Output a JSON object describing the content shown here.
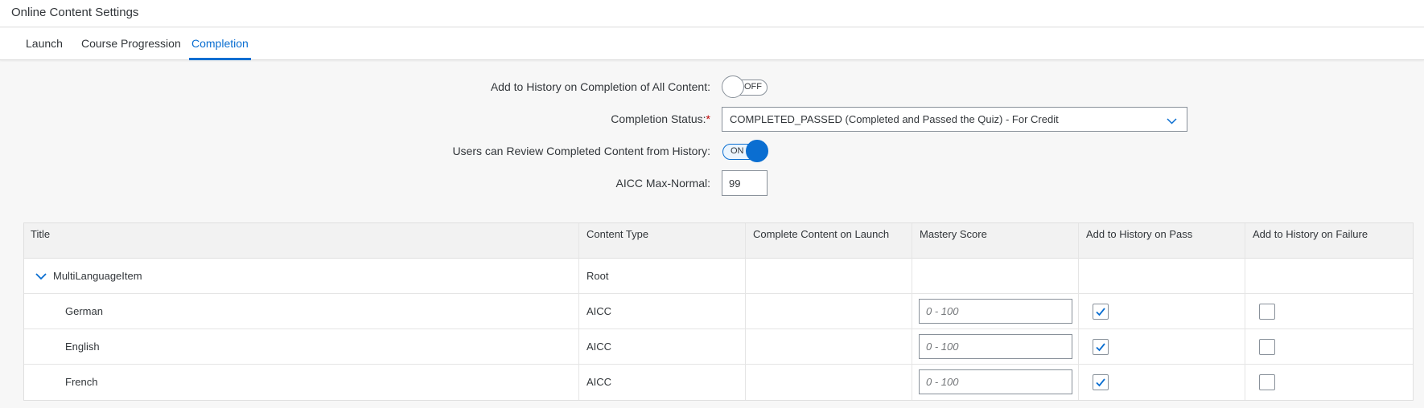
{
  "window": {
    "title": "Online Content Settings"
  },
  "tabs": [
    {
      "label": "Launch",
      "active": false
    },
    {
      "label": "Course Progression",
      "active": false
    },
    {
      "label": "Completion",
      "active": true
    }
  ],
  "form": {
    "add_history_label": "Add to History on Completion of All Content:",
    "add_history_state": "OFF",
    "completion_status_label": "Completion Status:",
    "completion_status_required": "*",
    "completion_status_value": "COMPLETED_PASSED (Completed and Passed the Quiz) - For Credit",
    "review_label": "Users can Review Completed Content from History:",
    "review_state": "ON",
    "aicc_label": "AICC Max-Normal:",
    "aicc_value": "99"
  },
  "table": {
    "columns": [
      "Title",
      "Content Type",
      "Complete Content on Launch",
      "Mastery Score",
      "Add to History on Pass",
      "Add to History on Failure"
    ],
    "root": {
      "title": "MultiLanguageItem",
      "content_type": "Root"
    },
    "rows": [
      {
        "title": "German",
        "content_type": "AICC",
        "mastery_placeholder": "0 - 100",
        "history_pass": true,
        "history_failure": false
      },
      {
        "title": "English",
        "content_type": "AICC",
        "mastery_placeholder": "0 - 100",
        "history_pass": true,
        "history_failure": false
      },
      {
        "title": "French",
        "content_type": "AICC",
        "mastery_placeholder": "0 - 100",
        "history_pass": true,
        "history_failure": false
      }
    ]
  },
  "colors": {
    "accent": "#0a6ed1",
    "required": "#bb0000",
    "border": "#89919a"
  },
  "icons": {
    "select": "chevron-down-icon",
    "expander": "chevron-down-icon",
    "checkbox": "checkmark-icon"
  }
}
